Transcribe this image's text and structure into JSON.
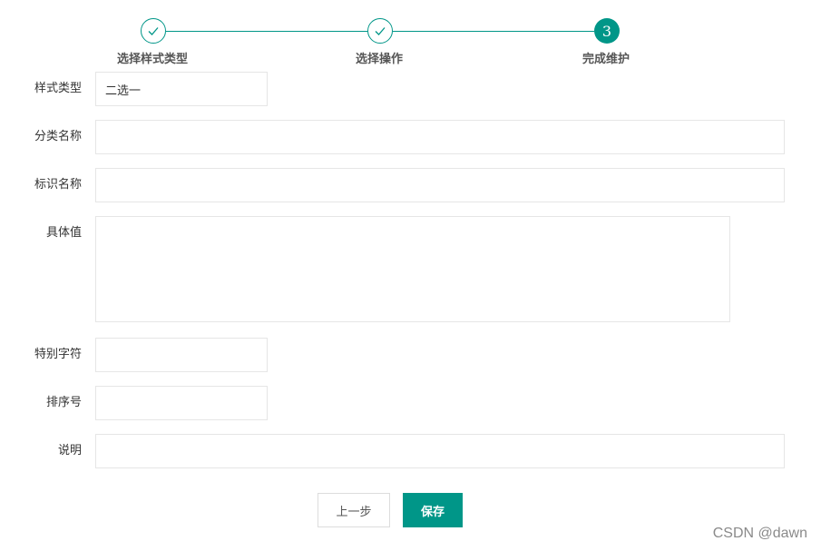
{
  "steps": [
    {
      "label": "选择样式类型",
      "state": "done",
      "icon": "check-icon"
    },
    {
      "label": "选择操作",
      "state": "done",
      "icon": "check-icon"
    },
    {
      "label": "完成维护",
      "state": "active",
      "number": "3"
    }
  ],
  "form": {
    "style_type": {
      "label": "样式类型",
      "value": "二选一"
    },
    "category_name": {
      "label": "分类名称",
      "value": ""
    },
    "identifier_name": {
      "label": "标识名称",
      "value": ""
    },
    "specific_value": {
      "label": "具体值",
      "value": ""
    },
    "special_char": {
      "label": "特别字符",
      "value": ""
    },
    "sort_number": {
      "label": "排序号",
      "value": ""
    },
    "description": {
      "label": "说明",
      "value": ""
    }
  },
  "buttons": {
    "prev": "上一步",
    "save": "保存"
  },
  "watermark": "CSDN @dawn",
  "colors": {
    "accent": "#009688",
    "border": "#e6e6e6"
  }
}
